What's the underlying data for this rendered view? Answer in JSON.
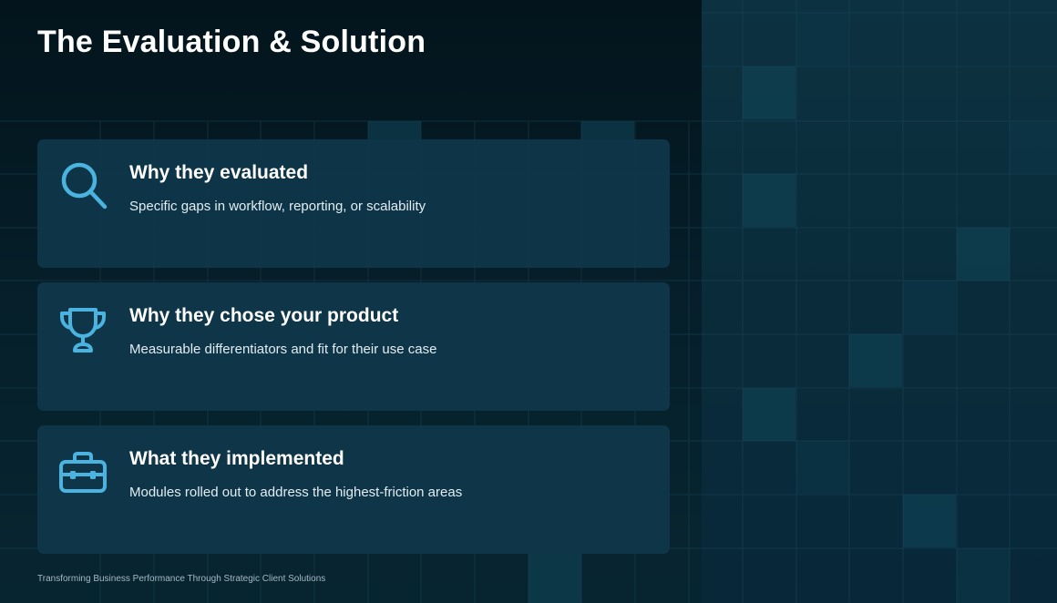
{
  "slide": {
    "title": "The Evaluation & Solution",
    "footer": "Transforming Business Performance Through Strategic Client Solutions"
  },
  "cards": [
    {
      "icon": "magnifier-icon",
      "title": "Why they evaluated",
      "description": "Specific gaps in workflow, reporting, or scalability"
    },
    {
      "icon": "trophy-icon",
      "title": "Why they chose your product",
      "description": "Measurable differentiators and fit for their use case"
    },
    {
      "icon": "toolbox-icon",
      "title": "What they implemented",
      "description": "Modules rolled out to address the highest-friction areas"
    }
  ],
  "colors": {
    "background": "#041821",
    "card": "#0f374a",
    "accent": "#4ab3e0",
    "title_text": "#ffffff"
  }
}
